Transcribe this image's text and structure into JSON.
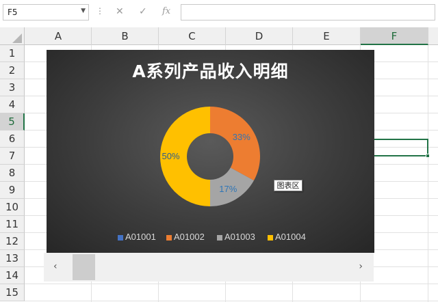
{
  "formula_bar": {
    "name_box": "F5",
    "cancel_icon": "✕",
    "enter_icon": "✓",
    "function_icon": "fx",
    "value": ""
  },
  "columns": [
    "A",
    "B",
    "C",
    "D",
    "E",
    "F"
  ],
  "active_column": "F",
  "rows": [
    "1",
    "2",
    "3",
    "4",
    "5",
    "6",
    "7",
    "8",
    "9",
    "10",
    "11",
    "12",
    "13",
    "14",
    "15"
  ],
  "active_row": "5",
  "chart": {
    "title": "A系列产品收入明细",
    "tooltip": "图表区",
    "background": "#3c3c3c"
  },
  "chart_data": {
    "type": "pie",
    "variant": "donut",
    "title": "A系列产品收入明细",
    "categories": [
      "A01001",
      "A01002",
      "A01003",
      "A01004"
    ],
    "values": [
      0,
      33,
      17,
      50
    ],
    "data_labels": [
      "",
      "33%",
      "17%",
      "50%"
    ],
    "colors": [
      "#4472c4",
      "#ed7d31",
      "#a5a5a5",
      "#ffc000"
    ],
    "legend_position": "bottom"
  },
  "scrollbar": {
    "left_arrow": "‹",
    "right_arrow": "›"
  }
}
